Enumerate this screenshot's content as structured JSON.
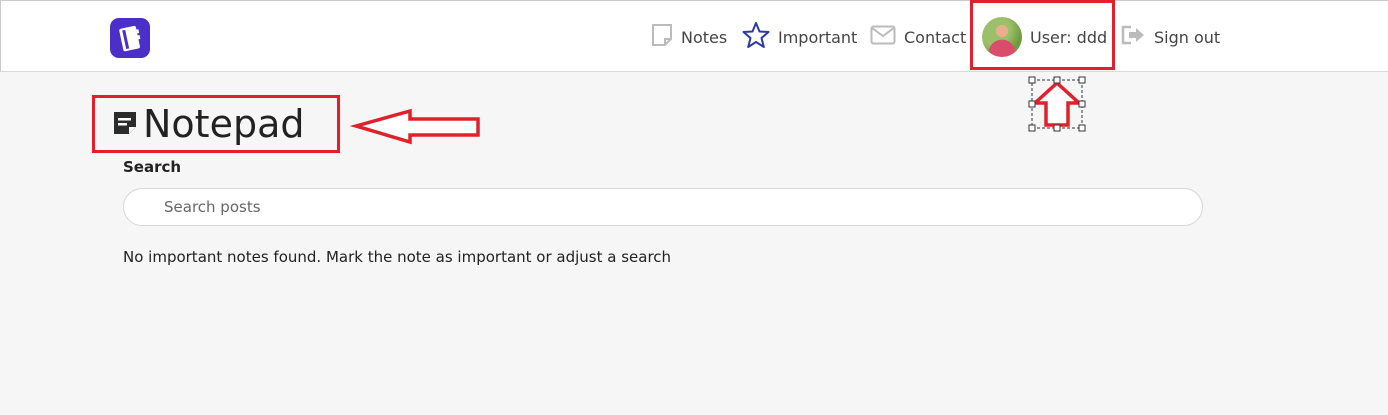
{
  "nav": {
    "notes_label": "Notes",
    "important_label": "Important",
    "contact_label": "Contact",
    "user_label": "User: ddd",
    "signout_label": "Sign out"
  },
  "page": {
    "title": "Notepad",
    "search_label": "Search",
    "search_placeholder": "Search posts",
    "empty_message": "No important notes found. Mark the note as important or adjust a search"
  },
  "icons": {
    "logo": "notebook-logo-icon",
    "notes": "sticky-note-icon",
    "important": "star-icon",
    "contact": "envelope-icon",
    "signout": "sign-out-icon",
    "title": "note-icon"
  },
  "colors": {
    "brand": "#4a2fc8",
    "star": "#2a3ba8",
    "annotation": "#e0202a",
    "background": "#f6f6f6"
  }
}
